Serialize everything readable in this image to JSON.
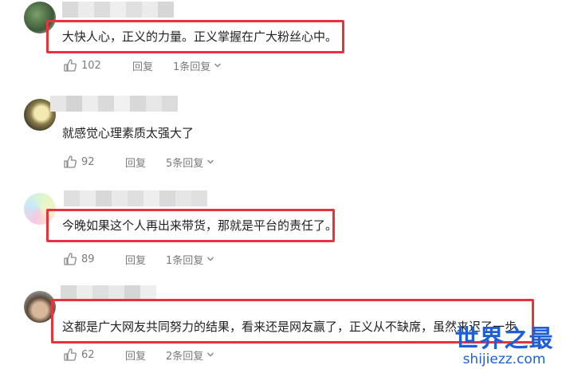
{
  "comments": [
    {
      "text": "大快人心，正义的力量。正义掌握在广大粉丝心中。",
      "likes": "102",
      "reply_label": "回复",
      "replies_label": "1条回复"
    },
    {
      "text": "就感觉心理素质太强大了",
      "likes": "92",
      "reply_label": "回复",
      "replies_label": "5条回复"
    },
    {
      "text": "今晚如果这个人再出来带货，那就是平台的责任了。",
      "likes": "89",
      "reply_label": "回复",
      "replies_label": "1条回复"
    },
    {
      "text": "这都是广大网友共同努力的结果，看来还是网友赢了，正义从不缺席，虽然来迟了一步",
      "likes": "62",
      "reply_label": "回复",
      "replies_label": "2条回复"
    }
  ],
  "watermark": {
    "line1": "世界之最",
    "line2": "shijiezz.com"
  },
  "colors": {
    "highlight": "#e8323c",
    "watermark": "#1f5fd6",
    "action_text": "#7a7a7a"
  }
}
